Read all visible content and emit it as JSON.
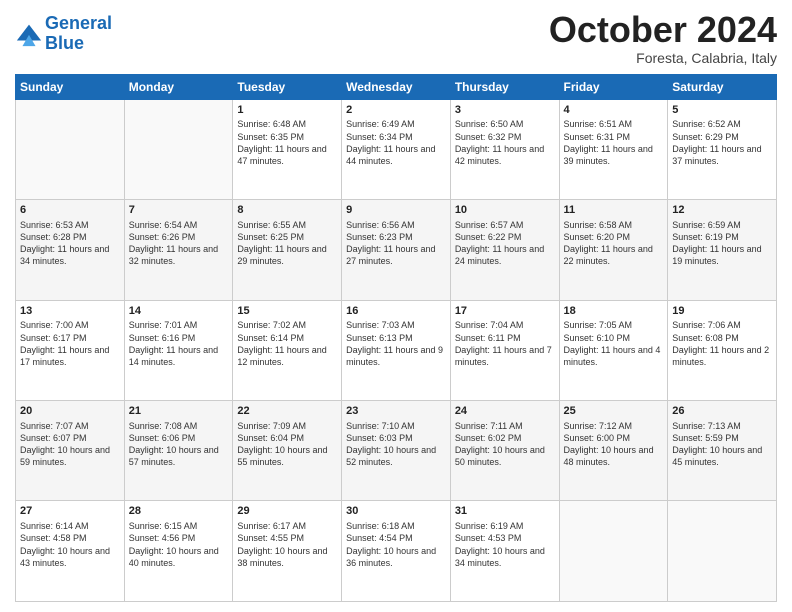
{
  "header": {
    "logo_line1": "General",
    "logo_line2": "Blue",
    "month": "October 2024",
    "location": "Foresta, Calabria, Italy"
  },
  "days_of_week": [
    "Sunday",
    "Monday",
    "Tuesday",
    "Wednesday",
    "Thursday",
    "Friday",
    "Saturday"
  ],
  "weeks": [
    [
      {
        "day": "",
        "info": ""
      },
      {
        "day": "",
        "info": ""
      },
      {
        "day": "1",
        "sunrise": "6:48 AM",
        "sunset": "6:35 PM",
        "daylight": "11 hours and 47 minutes."
      },
      {
        "day": "2",
        "sunrise": "6:49 AM",
        "sunset": "6:34 PM",
        "daylight": "11 hours and 44 minutes."
      },
      {
        "day": "3",
        "sunrise": "6:50 AM",
        "sunset": "6:32 PM",
        "daylight": "11 hours and 42 minutes."
      },
      {
        "day": "4",
        "sunrise": "6:51 AM",
        "sunset": "6:31 PM",
        "daylight": "11 hours and 39 minutes."
      },
      {
        "day": "5",
        "sunrise": "6:52 AM",
        "sunset": "6:29 PM",
        "daylight": "11 hours and 37 minutes."
      }
    ],
    [
      {
        "day": "6",
        "sunrise": "6:53 AM",
        "sunset": "6:28 PM",
        "daylight": "11 hours and 34 minutes."
      },
      {
        "day": "7",
        "sunrise": "6:54 AM",
        "sunset": "6:26 PM",
        "daylight": "11 hours and 32 minutes."
      },
      {
        "day": "8",
        "sunrise": "6:55 AM",
        "sunset": "6:25 PM",
        "daylight": "11 hours and 29 minutes."
      },
      {
        "day": "9",
        "sunrise": "6:56 AM",
        "sunset": "6:23 PM",
        "daylight": "11 hours and 27 minutes."
      },
      {
        "day": "10",
        "sunrise": "6:57 AM",
        "sunset": "6:22 PM",
        "daylight": "11 hours and 24 minutes."
      },
      {
        "day": "11",
        "sunrise": "6:58 AM",
        "sunset": "6:20 PM",
        "daylight": "11 hours and 22 minutes."
      },
      {
        "day": "12",
        "sunrise": "6:59 AM",
        "sunset": "6:19 PM",
        "daylight": "11 hours and 19 minutes."
      }
    ],
    [
      {
        "day": "13",
        "sunrise": "7:00 AM",
        "sunset": "6:17 PM",
        "daylight": "11 hours and 17 minutes."
      },
      {
        "day": "14",
        "sunrise": "7:01 AM",
        "sunset": "6:16 PM",
        "daylight": "11 hours and 14 minutes."
      },
      {
        "day": "15",
        "sunrise": "7:02 AM",
        "sunset": "6:14 PM",
        "daylight": "11 hours and 12 minutes."
      },
      {
        "day": "16",
        "sunrise": "7:03 AM",
        "sunset": "6:13 PM",
        "daylight": "11 hours and 9 minutes."
      },
      {
        "day": "17",
        "sunrise": "7:04 AM",
        "sunset": "6:11 PM",
        "daylight": "11 hours and 7 minutes."
      },
      {
        "day": "18",
        "sunrise": "7:05 AM",
        "sunset": "6:10 PM",
        "daylight": "11 hours and 4 minutes."
      },
      {
        "day": "19",
        "sunrise": "7:06 AM",
        "sunset": "6:08 PM",
        "daylight": "11 hours and 2 minutes."
      }
    ],
    [
      {
        "day": "20",
        "sunrise": "7:07 AM",
        "sunset": "6:07 PM",
        "daylight": "10 hours and 59 minutes."
      },
      {
        "day": "21",
        "sunrise": "7:08 AM",
        "sunset": "6:06 PM",
        "daylight": "10 hours and 57 minutes."
      },
      {
        "day": "22",
        "sunrise": "7:09 AM",
        "sunset": "6:04 PM",
        "daylight": "10 hours and 55 minutes."
      },
      {
        "day": "23",
        "sunrise": "7:10 AM",
        "sunset": "6:03 PM",
        "daylight": "10 hours and 52 minutes."
      },
      {
        "day": "24",
        "sunrise": "7:11 AM",
        "sunset": "6:02 PM",
        "daylight": "10 hours and 50 minutes."
      },
      {
        "day": "25",
        "sunrise": "7:12 AM",
        "sunset": "6:00 PM",
        "daylight": "10 hours and 48 minutes."
      },
      {
        "day": "26",
        "sunrise": "7:13 AM",
        "sunset": "5:59 PM",
        "daylight": "10 hours and 45 minutes."
      }
    ],
    [
      {
        "day": "27",
        "sunrise": "6:14 AM",
        "sunset": "4:58 PM",
        "daylight": "10 hours and 43 minutes."
      },
      {
        "day": "28",
        "sunrise": "6:15 AM",
        "sunset": "4:56 PM",
        "daylight": "10 hours and 40 minutes."
      },
      {
        "day": "29",
        "sunrise": "6:17 AM",
        "sunset": "4:55 PM",
        "daylight": "10 hours and 38 minutes."
      },
      {
        "day": "30",
        "sunrise": "6:18 AM",
        "sunset": "4:54 PM",
        "daylight": "10 hours and 36 minutes."
      },
      {
        "day": "31",
        "sunrise": "6:19 AM",
        "sunset": "4:53 PM",
        "daylight": "10 hours and 34 minutes."
      },
      {
        "day": "",
        "info": ""
      },
      {
        "day": "",
        "info": ""
      }
    ]
  ]
}
